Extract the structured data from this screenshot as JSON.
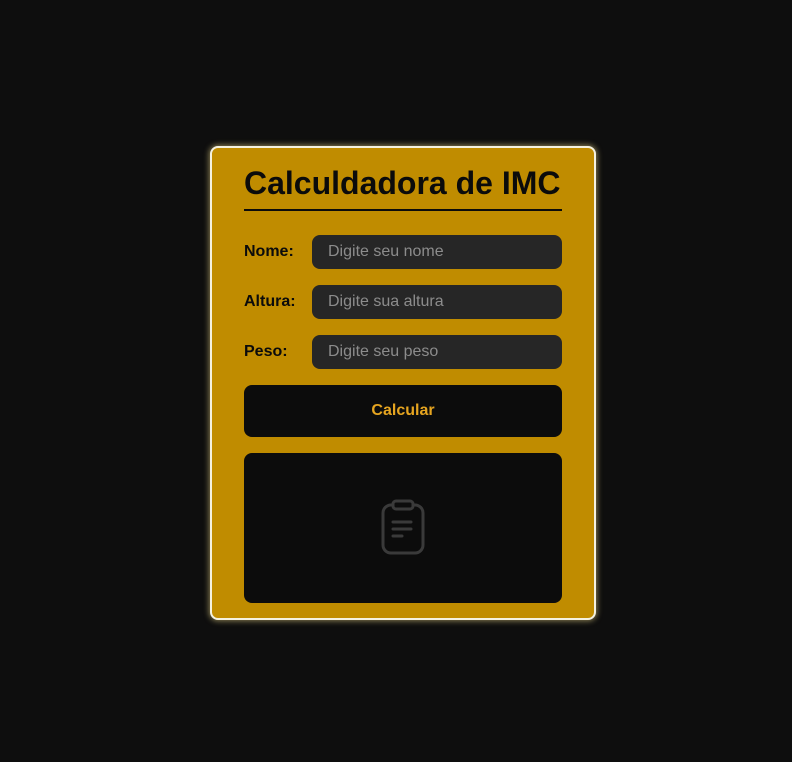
{
  "card": {
    "title": "Calculdadora de IMC"
  },
  "form": {
    "fields": [
      {
        "label": "Nome:",
        "placeholder": "Digite seu nome",
        "value": ""
      },
      {
        "label": "Altura:",
        "placeholder": "Digite sua altura",
        "value": ""
      },
      {
        "label": "Peso:",
        "placeholder": "Digite seu peso",
        "value": ""
      }
    ],
    "submit_label": "Calcular"
  },
  "result": {
    "icon": "clipboard-icon"
  },
  "colors": {
    "background": "#0e0e0e",
    "card": "#c08c00",
    "card_border": "#f4f1e0",
    "input_bg": "#262626",
    "button_bg": "#0c0c0c",
    "button_text": "#e6a520",
    "icon": "#3a3a3a"
  }
}
